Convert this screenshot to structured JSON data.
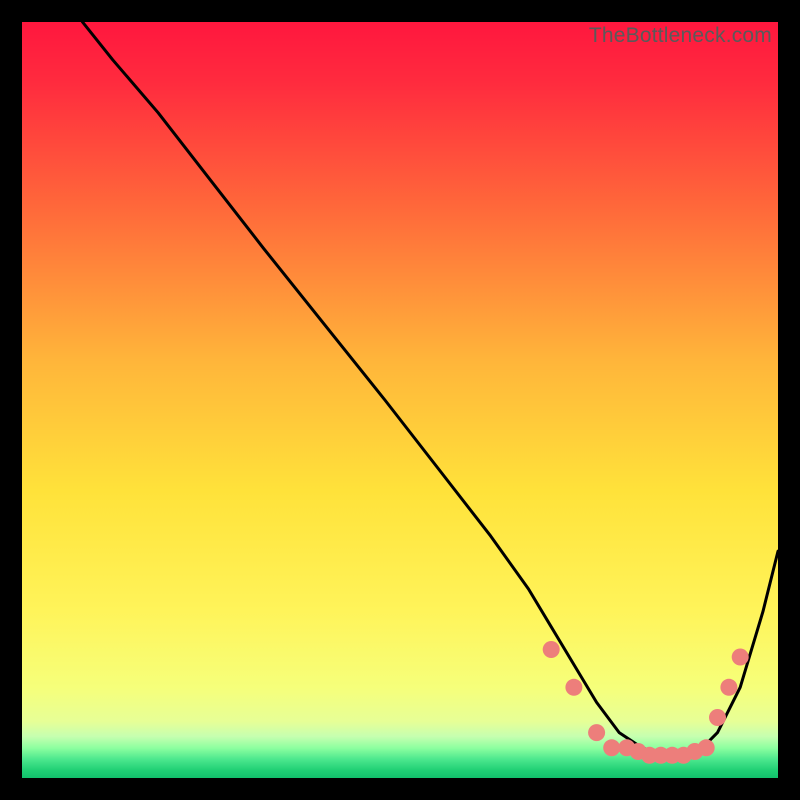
{
  "watermark": "TheBottleneck.com",
  "colors": {
    "gradient_top": "#ff173e",
    "gradient_mid1": "#ff6a3a",
    "gradient_mid2": "#ffd400",
    "gradient_mid3": "#fff45a",
    "gradient_mid4": "#f2ff8e",
    "gradient_bottom_band1": "#a8ff9e",
    "gradient_bottom_band2": "#35e07a",
    "point_fill": "#ed7e7b",
    "curve_stroke": "#000000",
    "frame_bg": "#000000"
  },
  "chart_data": {
    "type": "line",
    "title": "",
    "xlabel": "",
    "ylabel": "",
    "xlim": [
      0,
      100
    ],
    "ylim": [
      0,
      100
    ],
    "series": [
      {
        "name": "curve",
        "x": [
          8,
          12,
          18,
          25,
          32,
          40,
          48,
          55,
          62,
          67,
          70,
          73,
          76,
          79,
          82,
          85,
          88,
          90,
          92,
          95,
          98,
          100
        ],
        "y": [
          100,
          95,
          88,
          79,
          70,
          60,
          50,
          41,
          32,
          25,
          20,
          15,
          10,
          6,
          4,
          3,
          3,
          4,
          6,
          12,
          22,
          30
        ]
      }
    ],
    "points": [
      {
        "x": 70,
        "y": 17
      },
      {
        "x": 73,
        "y": 12
      },
      {
        "x": 76,
        "y": 6
      },
      {
        "x": 78,
        "y": 4
      },
      {
        "x": 80,
        "y": 4
      },
      {
        "x": 81.5,
        "y": 3.5
      },
      {
        "x": 83,
        "y": 3
      },
      {
        "x": 84.5,
        "y": 3
      },
      {
        "x": 86,
        "y": 3
      },
      {
        "x": 87.5,
        "y": 3
      },
      {
        "x": 89,
        "y": 3.5
      },
      {
        "x": 90.5,
        "y": 4
      },
      {
        "x": 92,
        "y": 8
      },
      {
        "x": 93.5,
        "y": 12
      },
      {
        "x": 95,
        "y": 16
      }
    ]
  }
}
